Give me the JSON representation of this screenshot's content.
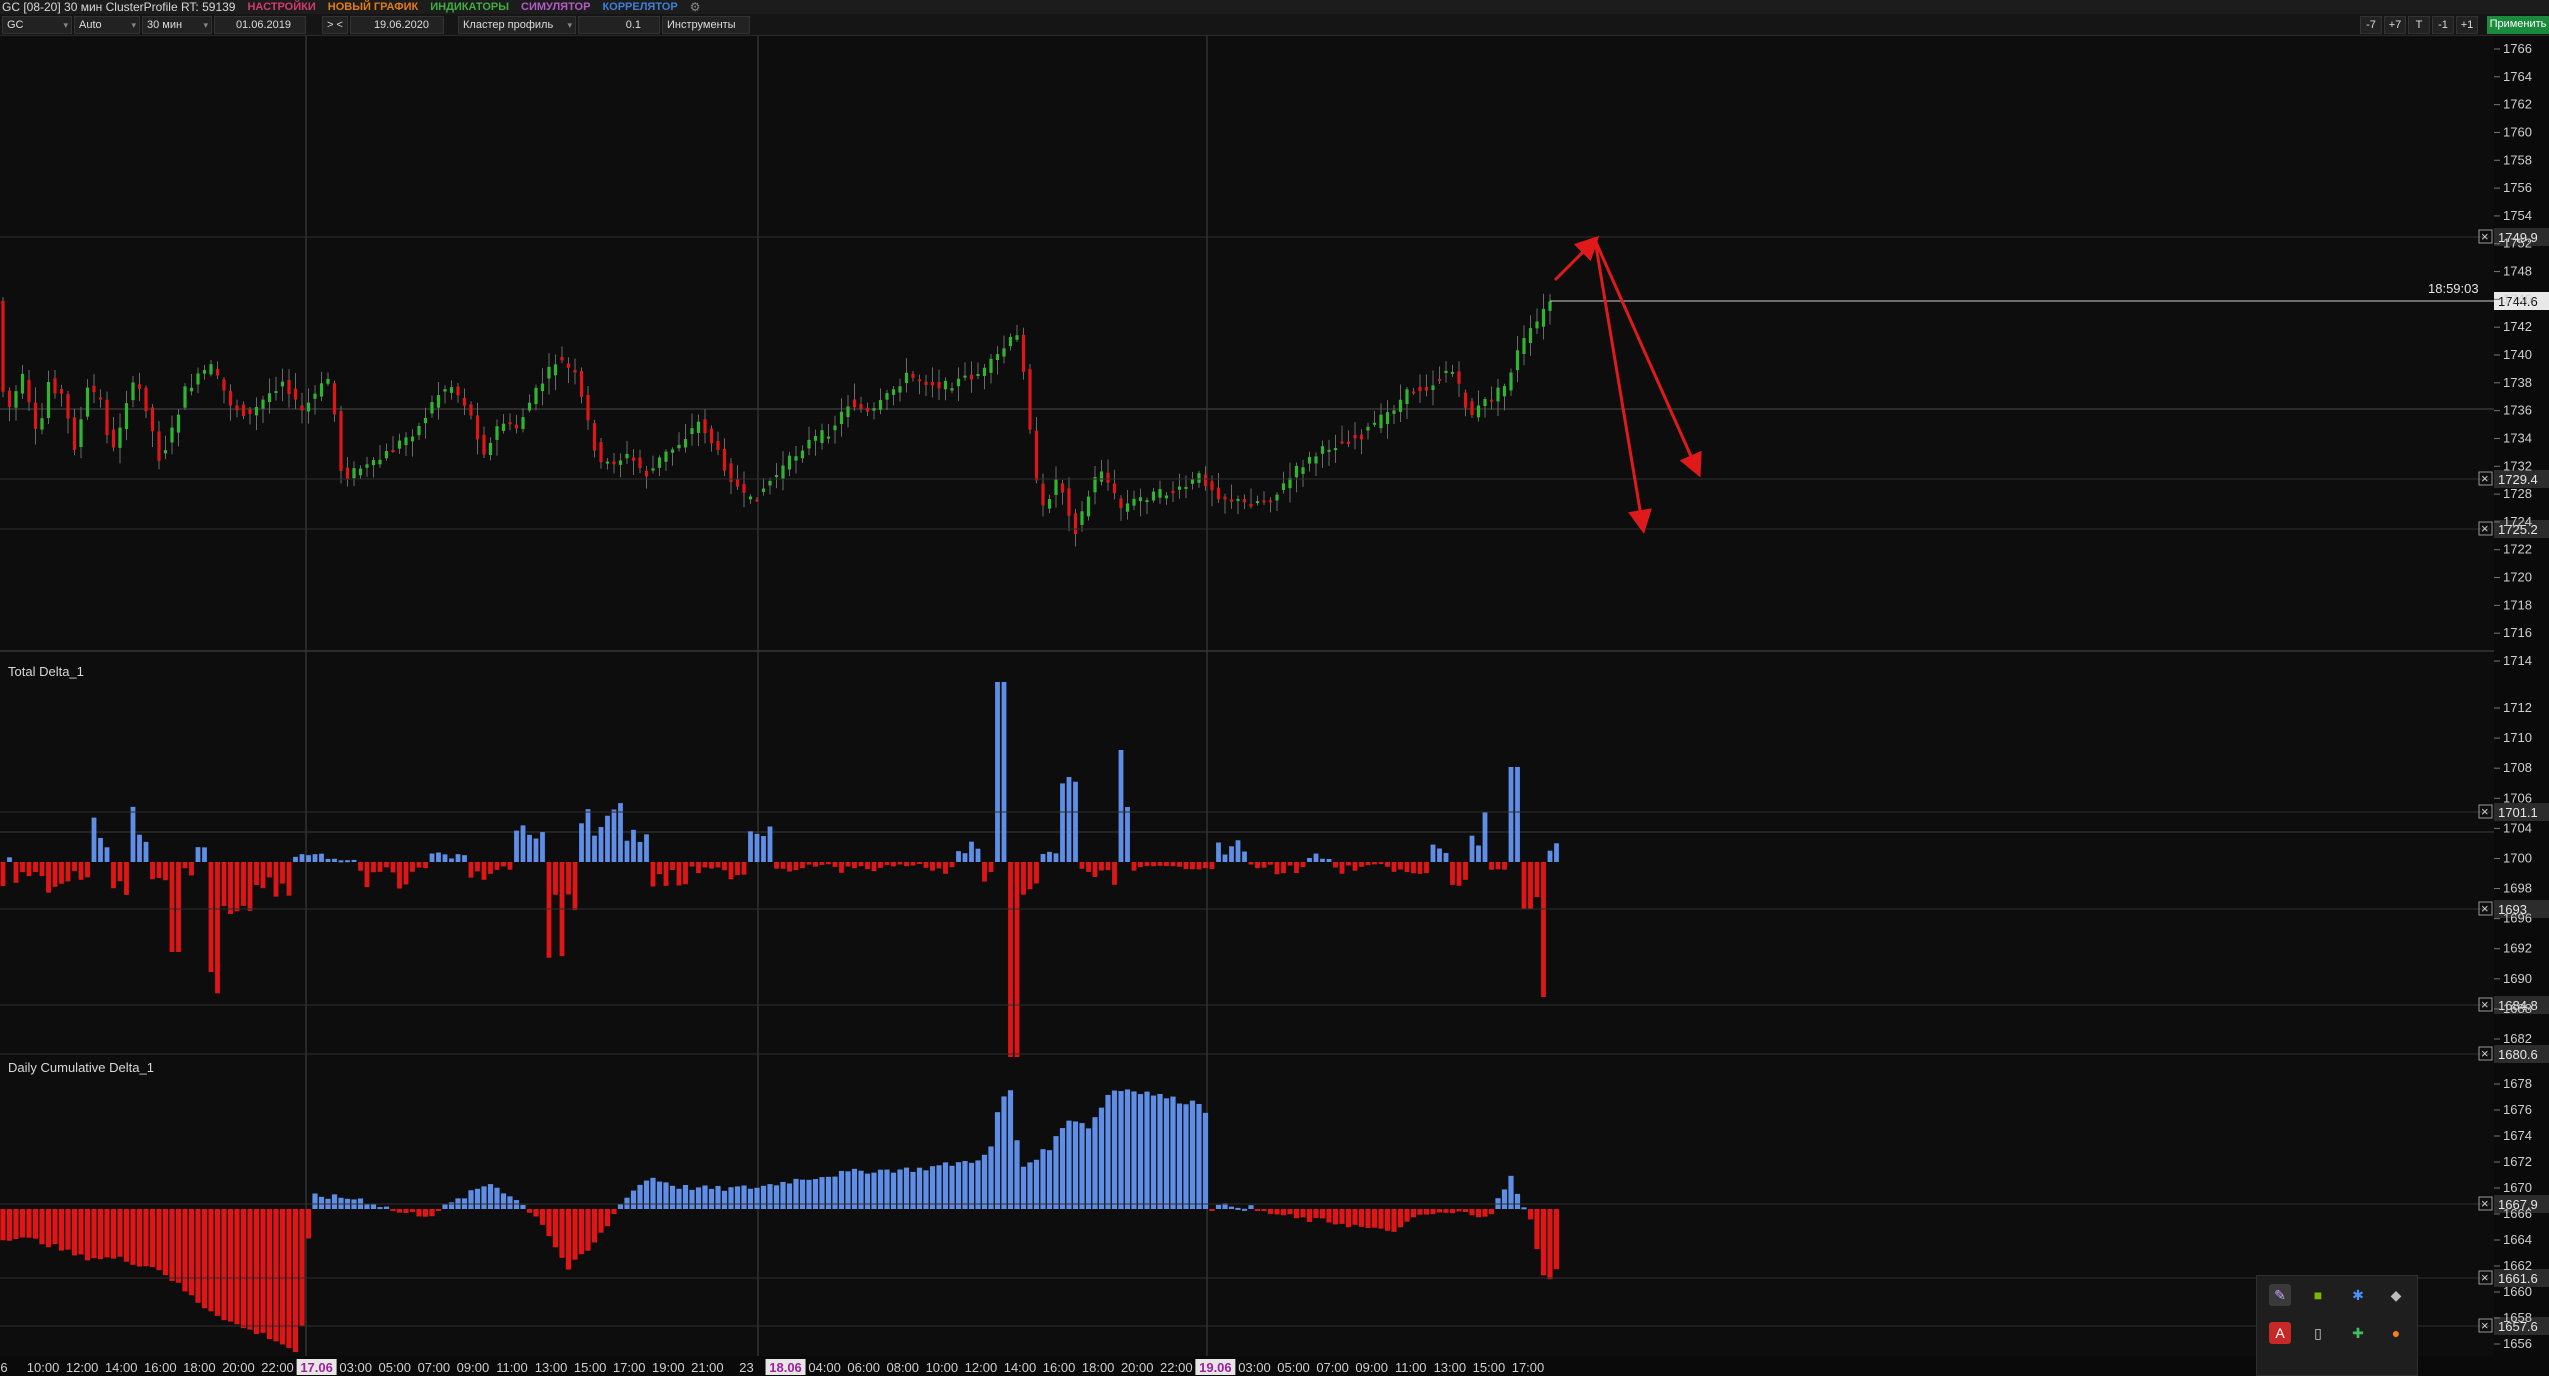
{
  "title": "GC [08-20] 30 мин ClusterProfile RT: 59139",
  "menu": [
    {
      "label": "НАСТРОЙКИ",
      "color": "#d13b6e"
    },
    {
      "label": "НОВЫЙ ГРАФИК",
      "color": "#e07b1a"
    },
    {
      "label": "ИНДИКАТОРЫ",
      "color": "#3fae3f"
    },
    {
      "label": "СИМУЛЯТОР",
      "color": "#b35cc9"
    },
    {
      "label": "КОРРЕЛЯТОР",
      "color": "#3f7fd6"
    }
  ],
  "toolbar": {
    "symbol": "GC",
    "scale_mode": "Auto",
    "timeframe": "30 мин",
    "date_from": "01.06.2019",
    "nav_prev": "> <",
    "date_to": "19.06.2020",
    "profile_type": "Кластер профиль",
    "step": "0.1",
    "tools": "Инструменты",
    "right_buttons": [
      "-7",
      "+7",
      "T",
      "-1",
      "+1"
    ],
    "apply": "Применить"
  },
  "price_panel": {
    "y_ticks": [
      "1766",
      "1764",
      "1762",
      "1760",
      "1758",
      "1756",
      "1754",
      "1752",
      "1748",
      "1746",
      "1742",
      "1740",
      "1738",
      "1736",
      "1734",
      "1732",
      "1728",
      "1724",
      "1722",
      "1720",
      "1718",
      "1716",
      "1714"
    ],
    "levels": [
      {
        "label": "1749.9"
      },
      {
        "label": "1729.4"
      },
      {
        "label": "1725.2"
      }
    ],
    "last_price": "1744.6",
    "timer": "18:59:03"
  },
  "delta_panel": {
    "title": "Total Delta_1",
    "y_ticks": [
      "1712",
      "1710",
      "1708",
      "1706",
      "1704",
      "1700",
      "1698",
      "1696",
      "1692",
      "1690",
      "1688",
      "1682"
    ],
    "levels": [
      {
        "label": "1701.1"
      },
      {
        "label": "1693"
      },
      {
        "label": "1684.8"
      },
      {
        "label": "1680.6"
      }
    ]
  },
  "cum_panel": {
    "title": "Daily Cumulative Delta_1",
    "y_ticks": [
      "1678",
      "1676",
      "1674",
      "1672",
      "1670",
      "1666",
      "1664",
      "1662",
      "1660",
      "1658",
      "1656"
    ],
    "levels": [
      {
        "label": "1667.9"
      },
      {
        "label": "1661.6"
      },
      {
        "label": "1657.6"
      }
    ]
  },
  "x_axis": {
    "labels": [
      "6",
      "10:00",
      "12:00",
      "14:00",
      "16:00",
      "18:00",
      "20:00",
      "22:00",
      "17.06",
      "03:00",
      "05:00",
      "07:00",
      "09:00",
      "11:00",
      "13:00",
      "15:00",
      "17:00",
      "19:00",
      "21:00",
      "23",
      "18.06",
      "04:00",
      "06:00",
      "08:00",
      "10:00",
      "12:00",
      "14:00",
      "16:00",
      "18:00",
      "20:00",
      "22:00",
      "19.06",
      "03:00",
      "05:00",
      "07:00",
      "09:00",
      "11:00",
      "13:00",
      "15:00",
      "17:00"
    ],
    "date_markers": [
      "17.06",
      "18.06",
      "19.06"
    ]
  },
  "colors": {
    "bull": "#2fb52f",
    "bear": "#e01515",
    "delta_pos": "#5f8ee6",
    "delta_neg": "#e01515",
    "annotation": "#e01a1a",
    "apply_button": "#1a8a3c"
  },
  "tray_icons": [
    "feather-icon",
    "nvidia-icon",
    "bluetooth-icon",
    "diamond-icon",
    "acrobat-icon",
    "usb-icon",
    "xbox-icon",
    "fire-icon"
  ]
}
